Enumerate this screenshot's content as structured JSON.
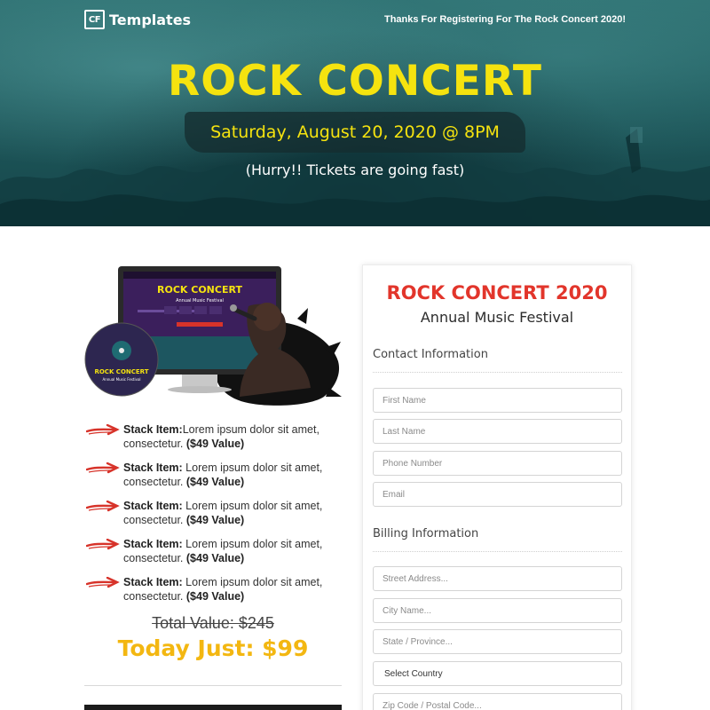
{
  "header": {
    "logo_mark": "CF",
    "logo_text": "Templates",
    "thanks": "Thanks For Registering For The Rock Concert 2020!"
  },
  "hero": {
    "title": "ROCK CONCERT",
    "date": "Saturday, August 20, 2020 @ 8PM",
    "hurry": "(Hurry!! Tickets are going fast)"
  },
  "product": {
    "screen_title": "ROCK CONCERT",
    "screen_subtitle": "Annual Music Festival",
    "disc_title": "ROCK CONCERT",
    "disc_subtitle": "Annual Music Festival"
  },
  "stack": [
    {
      "label": "Stack Item:",
      "text": "Lorem ipsum dolor sit amet, consectetur.",
      "value": "($49 Value)"
    },
    {
      "label": "Stack Item:",
      "text": " Lorem ipsum dolor sit amet, consectetur.",
      "value": "($49 Value)"
    },
    {
      "label": "Stack Item:",
      "text": " Lorem ipsum dolor sit amet, consectetur.",
      "value": "($49 Value)"
    },
    {
      "label": "Stack Item:",
      "text": " Lorem ipsum dolor sit amet, consectetur.",
      "value": "($49 Value)"
    },
    {
      "label": "Stack Item:",
      "text": " Lorem ipsum dolor sit amet, consectetur.",
      "value": "($49 Value)"
    }
  ],
  "pricing": {
    "total": "Total Value: $245",
    "today": "Today Just: $99"
  },
  "form": {
    "title": "ROCK CONCERT 2020",
    "subtitle": "Annual Music Festival",
    "contact_heading": "Contact Information",
    "first_name": "First Name",
    "last_name": "Last Name",
    "phone": "Phone Number",
    "email": "Email",
    "billing_heading": "Billing Information",
    "street": "Street Address...",
    "city": "City Name...",
    "state": "State / Province...",
    "country": "Select Country",
    "zip": "Zip Code / Postal Code..."
  },
  "colors": {
    "accent_yellow": "#f5e30f",
    "price_yellow": "#f3b711",
    "title_red": "#e2352b",
    "hero_teal": "#1f5a5d"
  }
}
